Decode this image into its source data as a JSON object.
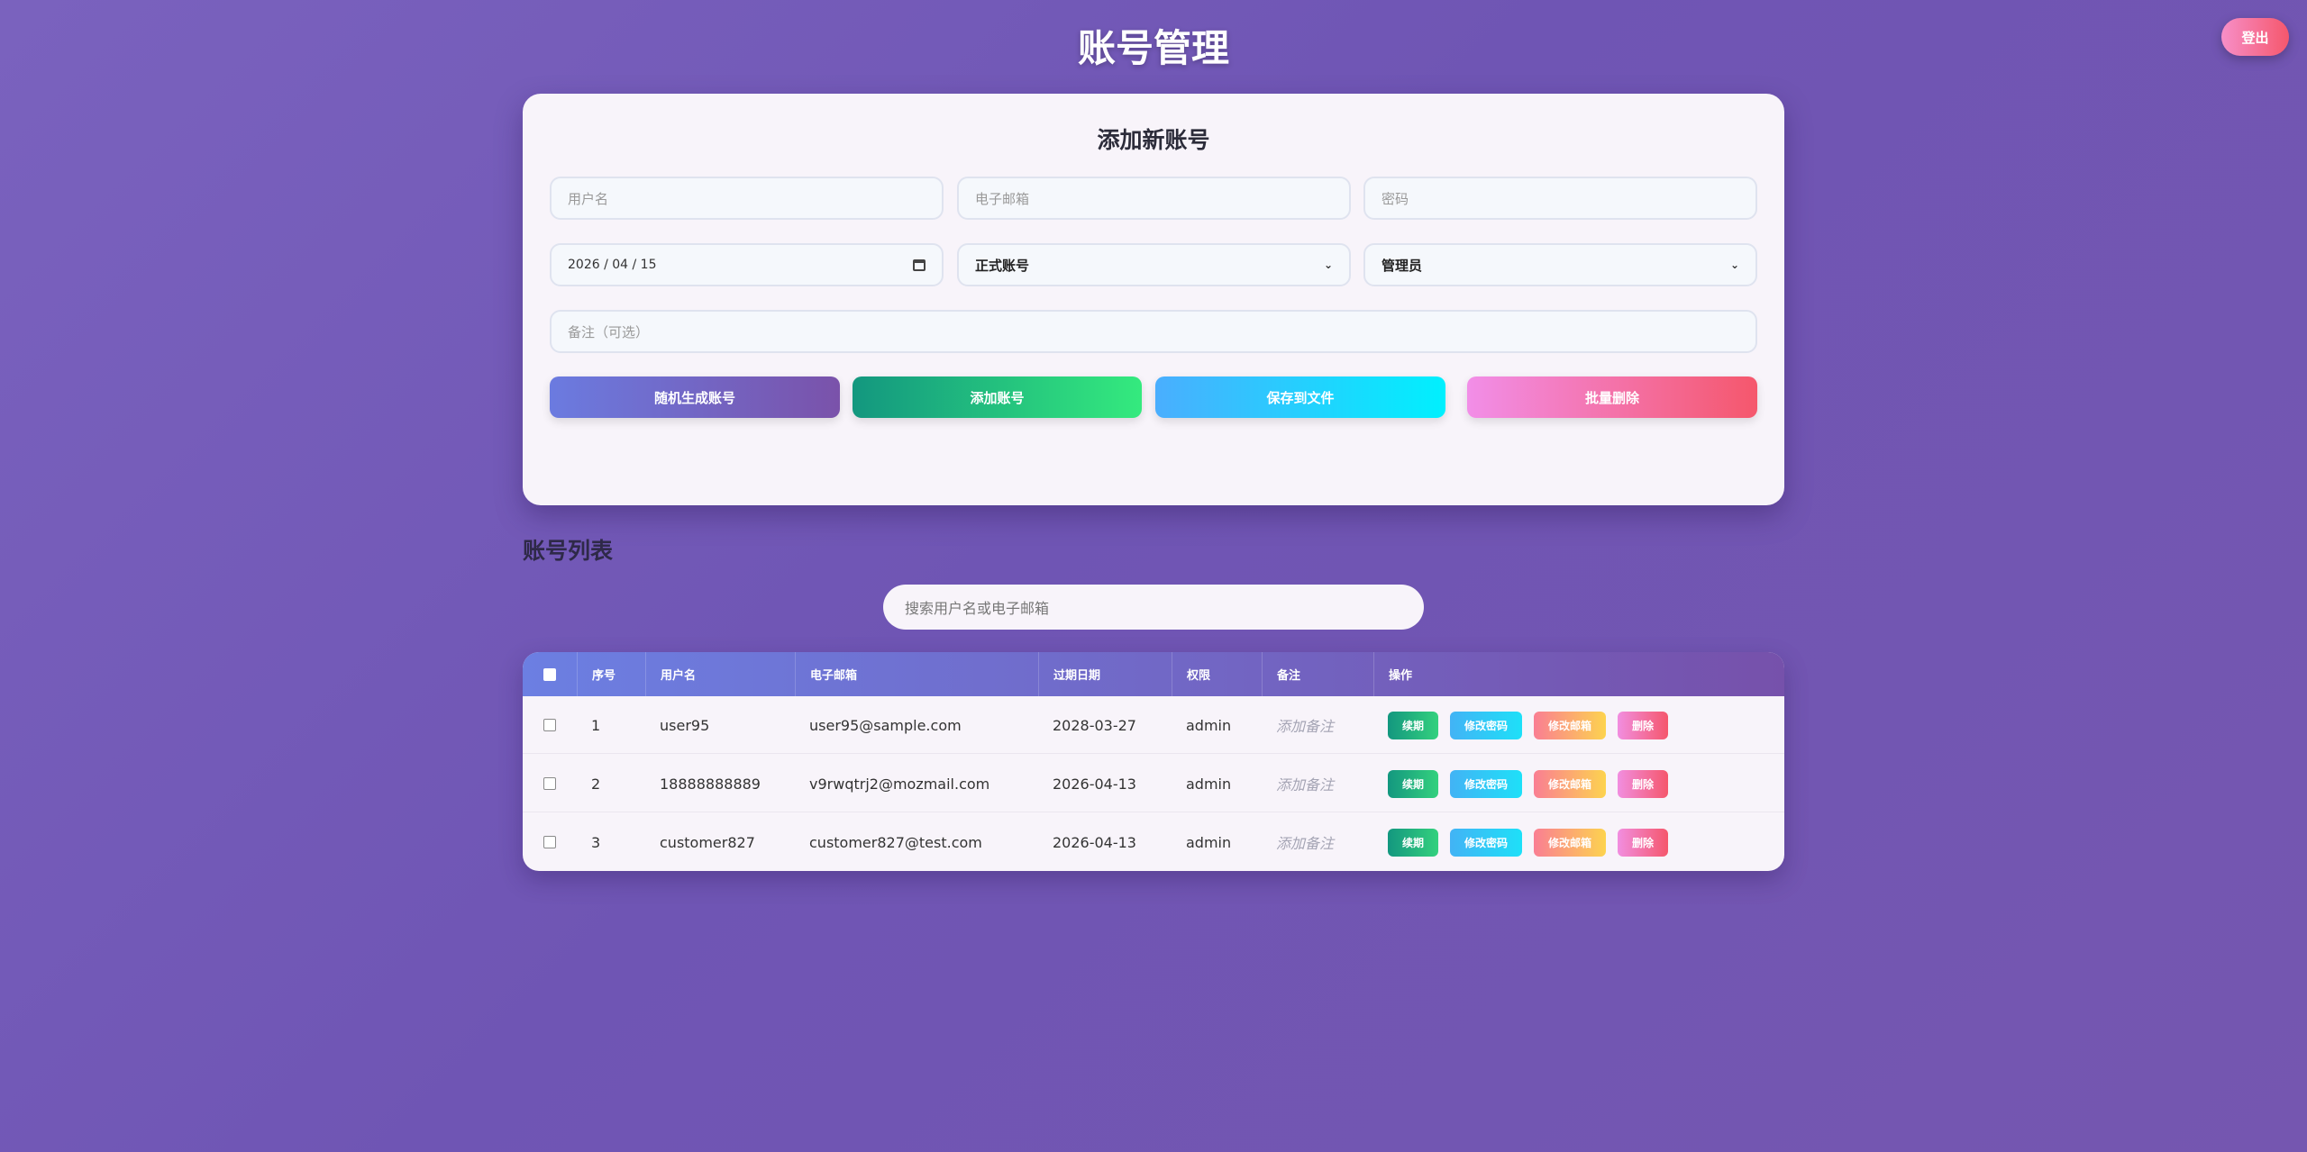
{
  "header": {
    "title": "账号管理",
    "logout_label": "登出"
  },
  "form": {
    "title": "添加新账号",
    "username_placeholder": "用户名",
    "email_placeholder": "电子邮箱",
    "password_placeholder": "密码",
    "date_value": "2026 / 04 / 15",
    "account_type_value": "正式账号",
    "role_value": "管理员",
    "note_placeholder": "备注（可选）",
    "buttons": {
      "random": "随机生成账号",
      "add": "添加账号",
      "save": "保存到文件",
      "batch_delete": "批量删除"
    }
  },
  "list": {
    "title": "账号列表",
    "search_placeholder": "搜索用户名或电子邮箱",
    "columns": [
      "序号",
      "用户名",
      "电子邮箱",
      "过期日期",
      "权限",
      "备注",
      "操作"
    ],
    "note_placeholder": "添加备注",
    "actions": {
      "renew": "续期",
      "change_password": "修改密码",
      "change_email": "修改邮箱",
      "delete": "删除"
    },
    "rows": [
      {
        "index": "1",
        "username": "user95",
        "email": "user95@sample.com",
        "expiry": "2028-03-27",
        "role": "admin"
      },
      {
        "index": "2",
        "username": "18888888889",
        "email": "v9rwqtrj2@mozmail.com",
        "expiry": "2026-04-13",
        "role": "admin"
      },
      {
        "index": "3",
        "username": "customer827",
        "email": "customer827@test.com",
        "expiry": "2026-04-13",
        "role": "admin"
      }
    ]
  },
  "colors": {
    "background": "#7259b6",
    "card": "#f8f4fa",
    "header_gradient_start": "#6c7fe2",
    "header_gradient_end": "#7651ab"
  }
}
